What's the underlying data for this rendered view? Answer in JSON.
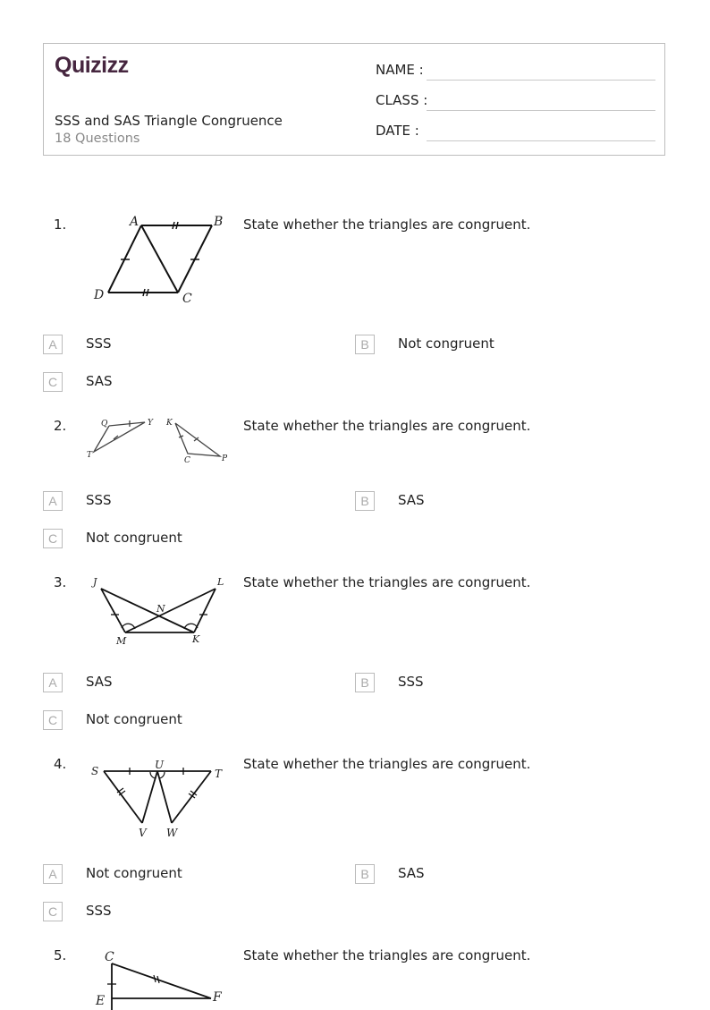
{
  "header": {
    "logo": "Quizizz",
    "title": "SSS and SAS Triangle Congruence",
    "subtitle": "18 Questions",
    "fields": [
      {
        "label": "NAME :"
      },
      {
        "label": "CLASS :"
      },
      {
        "label": "DATE  :"
      }
    ]
  },
  "questions": [
    {
      "number": "1.",
      "text": "State whether the triangles are congruent.",
      "figure_labels": [
        "A",
        "B",
        "C",
        "D"
      ],
      "options": [
        {
          "letter": "A",
          "text": "SSS"
        },
        {
          "letter": "B",
          "text": "Not congruent"
        },
        {
          "letter": "C",
          "text": "SAS"
        }
      ]
    },
    {
      "number": "2.",
      "text": "State whether the triangles are congruent.",
      "figure_labels": [
        "Q",
        "Y",
        "T",
        "K",
        "C",
        "P"
      ],
      "options": [
        {
          "letter": "A",
          "text": "SSS"
        },
        {
          "letter": "B",
          "text": "SAS"
        },
        {
          "letter": "C",
          "text": "Not congruent"
        }
      ]
    },
    {
      "number": "3.",
      "text": "State whether the triangles are congruent.",
      "figure_labels": [
        "J",
        "L",
        "N",
        "M",
        "K"
      ],
      "options": [
        {
          "letter": "A",
          "text": "SAS"
        },
        {
          "letter": "B",
          "text": "SSS"
        },
        {
          "letter": "C",
          "text": "Not congruent"
        }
      ]
    },
    {
      "number": "4.",
      "text": "State whether the triangles are congruent.",
      "figure_labels": [
        "S",
        "U",
        "T",
        "V",
        "W"
      ],
      "options": [
        {
          "letter": "A",
          "text": "Not congruent"
        },
        {
          "letter": "B",
          "text": "SAS"
        },
        {
          "letter": "C",
          "text": "SSS"
        }
      ]
    },
    {
      "number": "5.",
      "text": "State whether the triangles are congruent.",
      "figure_labels": [
        "C",
        "E",
        "F"
      ],
      "options": []
    }
  ]
}
